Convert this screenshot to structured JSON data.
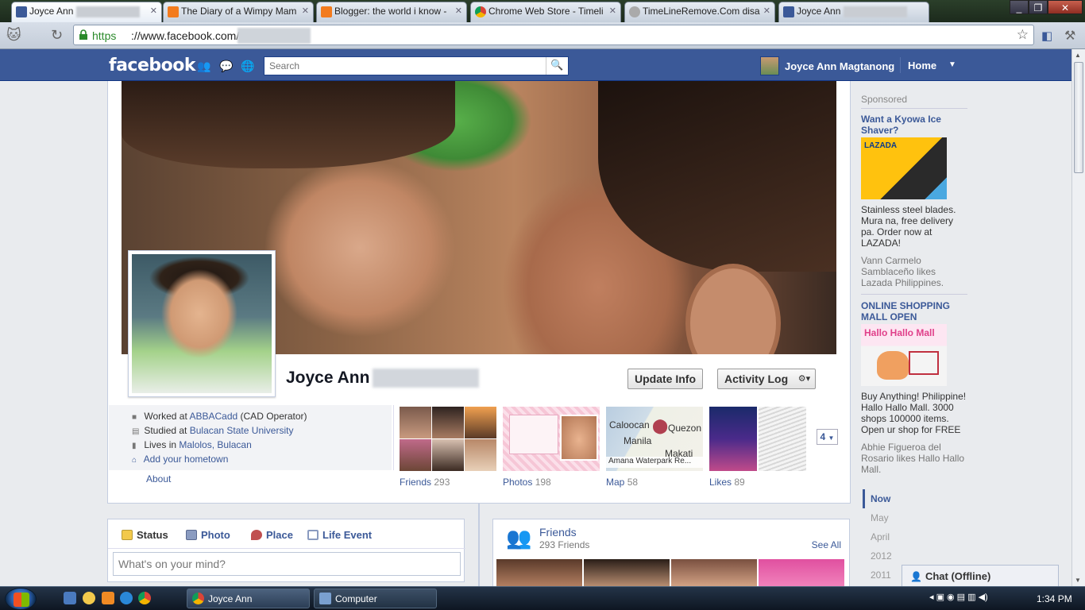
{
  "browser": {
    "tabs": [
      {
        "title": "Joyce Ann",
        "icon": "facebook-icon",
        "active": true
      },
      {
        "title": "The Diary of a Wimpy Mam",
        "icon": "blogger-icon"
      },
      {
        "title": "Blogger: the world i know -",
        "icon": "blogger-icon"
      },
      {
        "title": "Chrome Web Store - Timeli",
        "icon": "chrome-store-icon"
      },
      {
        "title": "TimeLineRemove.Com disa",
        "icon": "globe-icon"
      },
      {
        "title": "Joyce Ann",
        "icon": "facebook-icon"
      }
    ],
    "url_scheme": "https",
    "url_rest": "://www.facebook.com/",
    "window_buttons": [
      "_",
      "❐",
      "✕"
    ]
  },
  "header": {
    "logo": "facebook",
    "search_placeholder": "Search",
    "user_name": "Joyce Ann Magtanong",
    "home_label": "Home"
  },
  "profile": {
    "name": "Joyce Ann",
    "update_info": "Update Info",
    "activity_log": "Activity Log",
    "info": {
      "worked_prefix": "Worked at ",
      "worked_link": "ABBACadd",
      "worked_suffix": " (CAD Operator)",
      "studied_prefix": "Studied at ",
      "studied_link": "Bulacan State University",
      "lives_prefix": "Lives in ",
      "lives_link": "Malolos, Bulacan",
      "hometown": "Add your hometown"
    },
    "about_label": "About",
    "strip": [
      {
        "label": "Friends",
        "count": "293"
      },
      {
        "label": "Photos",
        "count": "198"
      },
      {
        "label": "Map",
        "count": "58"
      },
      {
        "label": "Likes",
        "count": "89"
      }
    ],
    "map_labels": {
      "a": "Caloocan",
      "b": "Quezon",
      "c": "Manila",
      "d": "Makati",
      "e": "Amana Waterpark Re..."
    },
    "more_count": "4"
  },
  "composer": {
    "tabs": [
      "Status",
      "Photo",
      "Place",
      "Life Event"
    ],
    "placeholder": "What's on your mind?"
  },
  "friends_box": {
    "title": "Friends",
    "count": "293 Friends",
    "see_all": "See All"
  },
  "sidebar": {
    "sponsored": "Sponsored",
    "ads": [
      {
        "title": "Want a Kyowa Ice Shaver?",
        "logo_text": "LAZADA",
        "body": "Stainless steel blades. Mura na, free delivery pa. Order now at LAZADA!",
        "social": "Vann Carmelo Samblaceño likes Lazada Philippines."
      },
      {
        "title": "ONLINE SHOPPING MALL OPEN",
        "logo_text": "Hallo Hallo Mall",
        "body": "Buy Anything! Philippine! Hallo Hallo Mall. 3000 shops 100000 items. Open ur shop for FREE",
        "social": "Abhie Figueroa del Rosario likes Hallo Hallo Mall."
      }
    ],
    "years": [
      "Now",
      "May",
      "April",
      "2012",
      "2011"
    ]
  },
  "chat": {
    "label": "Chat (Offline)"
  },
  "taskbar": {
    "buttons": [
      "Joyce Ann",
      "Computer"
    ],
    "time": "1:34 PM"
  },
  "colors": {
    "fb_blue": "#3b5998",
    "link": "#3b5998",
    "bg": "#e9ebee"
  }
}
